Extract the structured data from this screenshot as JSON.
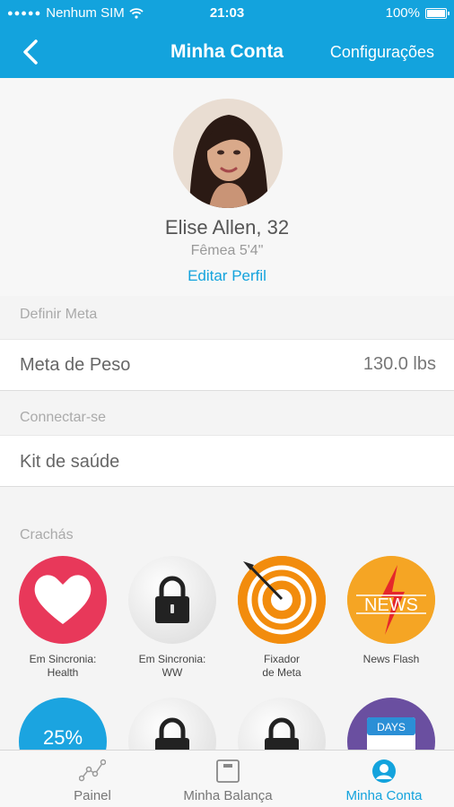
{
  "status_bar": {
    "carrier": "Nenhum SIM",
    "time": "21:03",
    "battery": "100%"
  },
  "nav": {
    "title": "Minha Conta",
    "settings_label": "Configurações"
  },
  "profile": {
    "name": "Elise Allen, 32",
    "details": "Fêmea 5'4\"",
    "edit_label": "Editar Perfil"
  },
  "goal_section": {
    "header": "Definir Meta",
    "row_label": "Meta de Peso",
    "row_value": "130.0 lbs"
  },
  "connect_section": {
    "header": "Connectar-se",
    "row_label": "Kit de saúde"
  },
  "badges": {
    "header": "Crachás",
    "items": [
      {
        "caption": "Em Sincronia:\nHealth",
        "icon": "heart-icon"
      },
      {
        "caption": "Em Sincronia:\nWW",
        "icon": "lock-icon"
      },
      {
        "caption": "Fixador\nde Meta",
        "icon": "target-icon"
      },
      {
        "caption": "News Flash",
        "icon": "news-icon",
        "text": "NEWS"
      },
      {
        "caption": "",
        "icon": "percent-icon",
        "text": "25%"
      },
      {
        "caption": "",
        "icon": "lock-icon"
      },
      {
        "caption": "",
        "icon": "lock-icon"
      },
      {
        "caption": "",
        "icon": "calendar-icon",
        "text": "DAYS"
      }
    ]
  },
  "tabs": [
    {
      "label": "Painel",
      "icon": "graph-icon"
    },
    {
      "label": "Minha Balança",
      "icon": "scale-icon"
    },
    {
      "label": "Minha Conta",
      "icon": "account-icon",
      "active": true
    }
  ],
  "colors": {
    "accent": "#13a3dd",
    "heart_badge": "#e8385a",
    "target_badge": "#f39c12",
    "news_badge": "#f6a623"
  }
}
